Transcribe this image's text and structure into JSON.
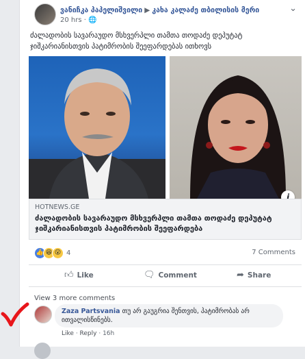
{
  "post": {
    "author": "ვანიჩკა პაპელიშვილი",
    "arrow": "▶",
    "target": "კახა კალაძე თბილისის მერი",
    "time": "20 hrs",
    "privacy_icon": "globe-icon",
    "text": "ძალადობის სავარაუდო მსხვერპლი თამთა თოდაძე დეპუტატ ჯიშკარიანისთვის პატიმრობის შეეფარდებას ითხოვს"
  },
  "link": {
    "domain": "HOTNEWS.GE",
    "title": "ძალადობის სავარაუდო მსხვერპლი თამთა თოდაძე დეპუტატ ჯიშკარიანისთვის პატიმრობის შეეფარდება",
    "info": "i"
  },
  "reactions": {
    "count": "4",
    "comments": "7 Comments"
  },
  "actions": {
    "like": "Like",
    "comment": "Comment",
    "share": "Share"
  },
  "comments": {
    "view_more": "View 3 more comments",
    "items": [
      {
        "name": "Zaza Partsvania",
        "text": "თუ არ გაუგრია შენთვის, პატიმრობას არ ითვალისწინებს.",
        "like": "Like",
        "reply": "Reply",
        "time": "16h"
      }
    ]
  },
  "colors": {
    "link_blue": "#365899",
    "annotation_red": "#e8161b"
  }
}
